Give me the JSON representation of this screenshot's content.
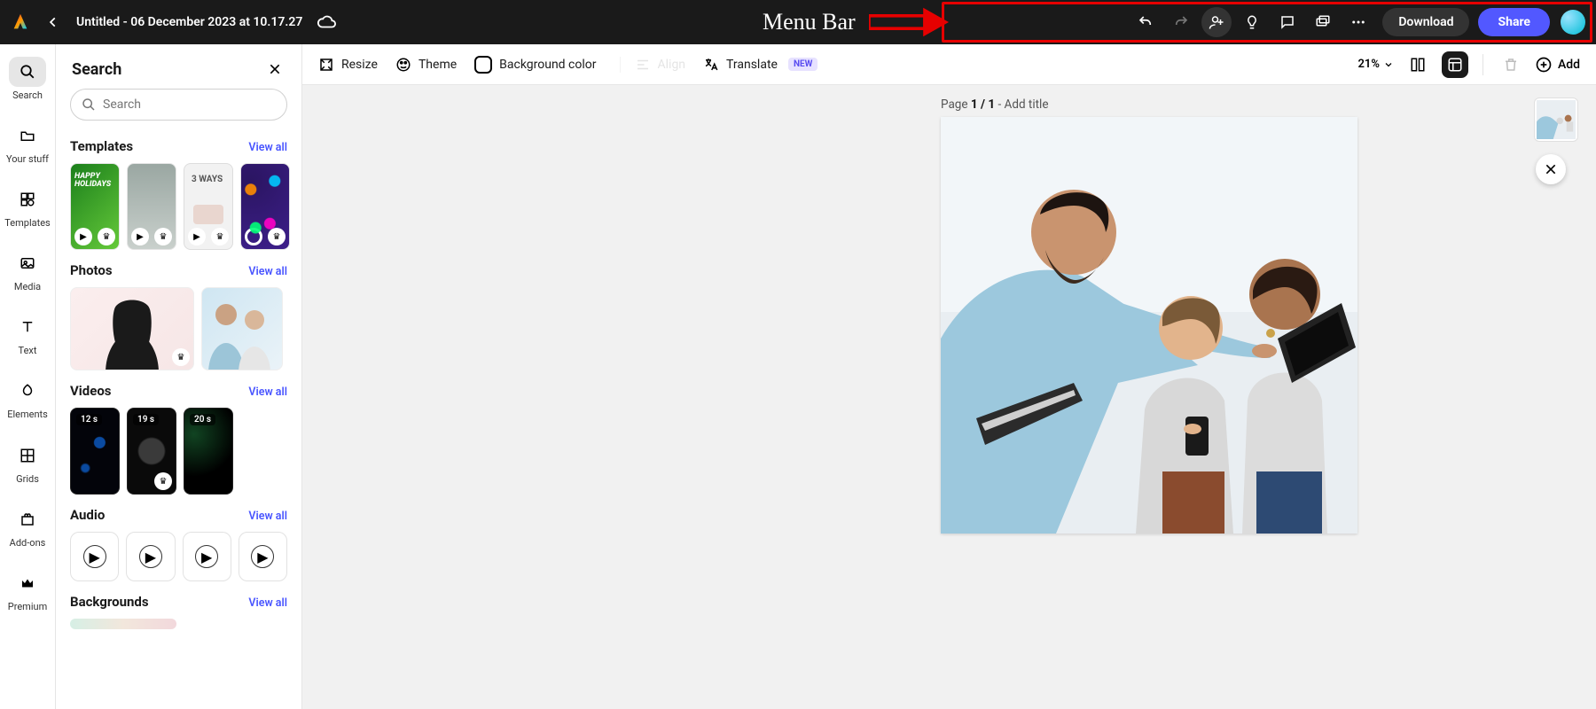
{
  "annotation": {
    "label": "Menu Bar"
  },
  "top": {
    "doc_title": "Untitled - 06 December 2023 at 10.17.27",
    "download": "Download",
    "share": "Share"
  },
  "rail": {
    "search": "Search",
    "your_stuff": "Your stuff",
    "templates": "Templates",
    "media": "Media",
    "text": "Text",
    "elements": "Elements",
    "grids": "Grids",
    "addons": "Add-ons",
    "premium": "Premium"
  },
  "panel": {
    "title": "Search",
    "search_placeholder": "Search",
    "templates": {
      "title": "Templates",
      "viewall": "View all"
    },
    "photos": {
      "title": "Photos",
      "viewall": "View all"
    },
    "videos": {
      "title": "Videos",
      "viewall": "View all",
      "d1": "12 s",
      "d2": "19 s",
      "d3": "20 s"
    },
    "audio": {
      "title": "Audio",
      "viewall": "View all"
    },
    "backgrounds": {
      "title": "Backgrounds",
      "viewall": "View all"
    }
  },
  "toolbar": {
    "resize": "Resize",
    "theme": "Theme",
    "bgcolor": "Background color",
    "align": "Align",
    "translate": "Translate",
    "new": "NEW",
    "zoom": "21%",
    "add": "Add"
  },
  "page": {
    "prefix": "Page ",
    "num": "1 / 1",
    "suffix": " - Add title"
  }
}
